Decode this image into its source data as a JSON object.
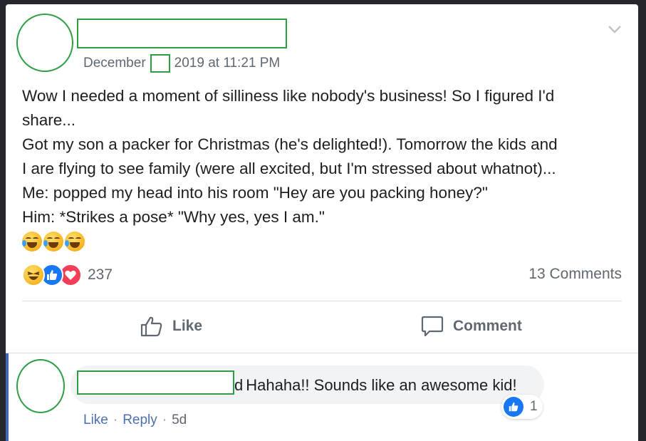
{
  "post": {
    "timestamp_month": "December",
    "timestamp_rest": "2019 at 11:21 PM",
    "lines": [
      "Wow I needed a moment of silliness like nobody's business! So I figured I'd",
      "share...",
      "Got my son a packer for Christmas (he's delighted!). Tomorrow the kids and",
      "I are flying to see family (were all excited, but I'm stressed about whatnot)...",
      "Me: popped my head into his room \"Hey are you packing honey?\"",
      "Him: *Strikes a pose* \"Why yes, yes I am.\""
    ],
    "emoji_icons": [
      "rolling-laughing-icon",
      "rolling-laughing-icon",
      "rolling-laughing-icon"
    ],
    "reaction_icons": [
      "haha-icon",
      "like-icon",
      "love-icon"
    ],
    "reaction_count": "237",
    "comments_count": "13 Comments"
  },
  "actions": {
    "like_label": "Like",
    "comment_label": "Comment"
  },
  "comment": {
    "visible_fragment": "d",
    "text": "Hahaha!! Sounds like an awesome kid!",
    "like_count": "1",
    "like_label": "Like",
    "reply_label": "Reply",
    "separator": "·",
    "age": "5d"
  },
  "colors": {
    "page_bg": "#25272d",
    "card_bg": "#ffffff",
    "redaction_border": "#2e9e44",
    "fb_blue": "#1877f2",
    "link_blue": "#4b6fb0",
    "secondary_text": "#606770",
    "love_red": "#f33e58",
    "accent_bar": "#4267b2"
  }
}
